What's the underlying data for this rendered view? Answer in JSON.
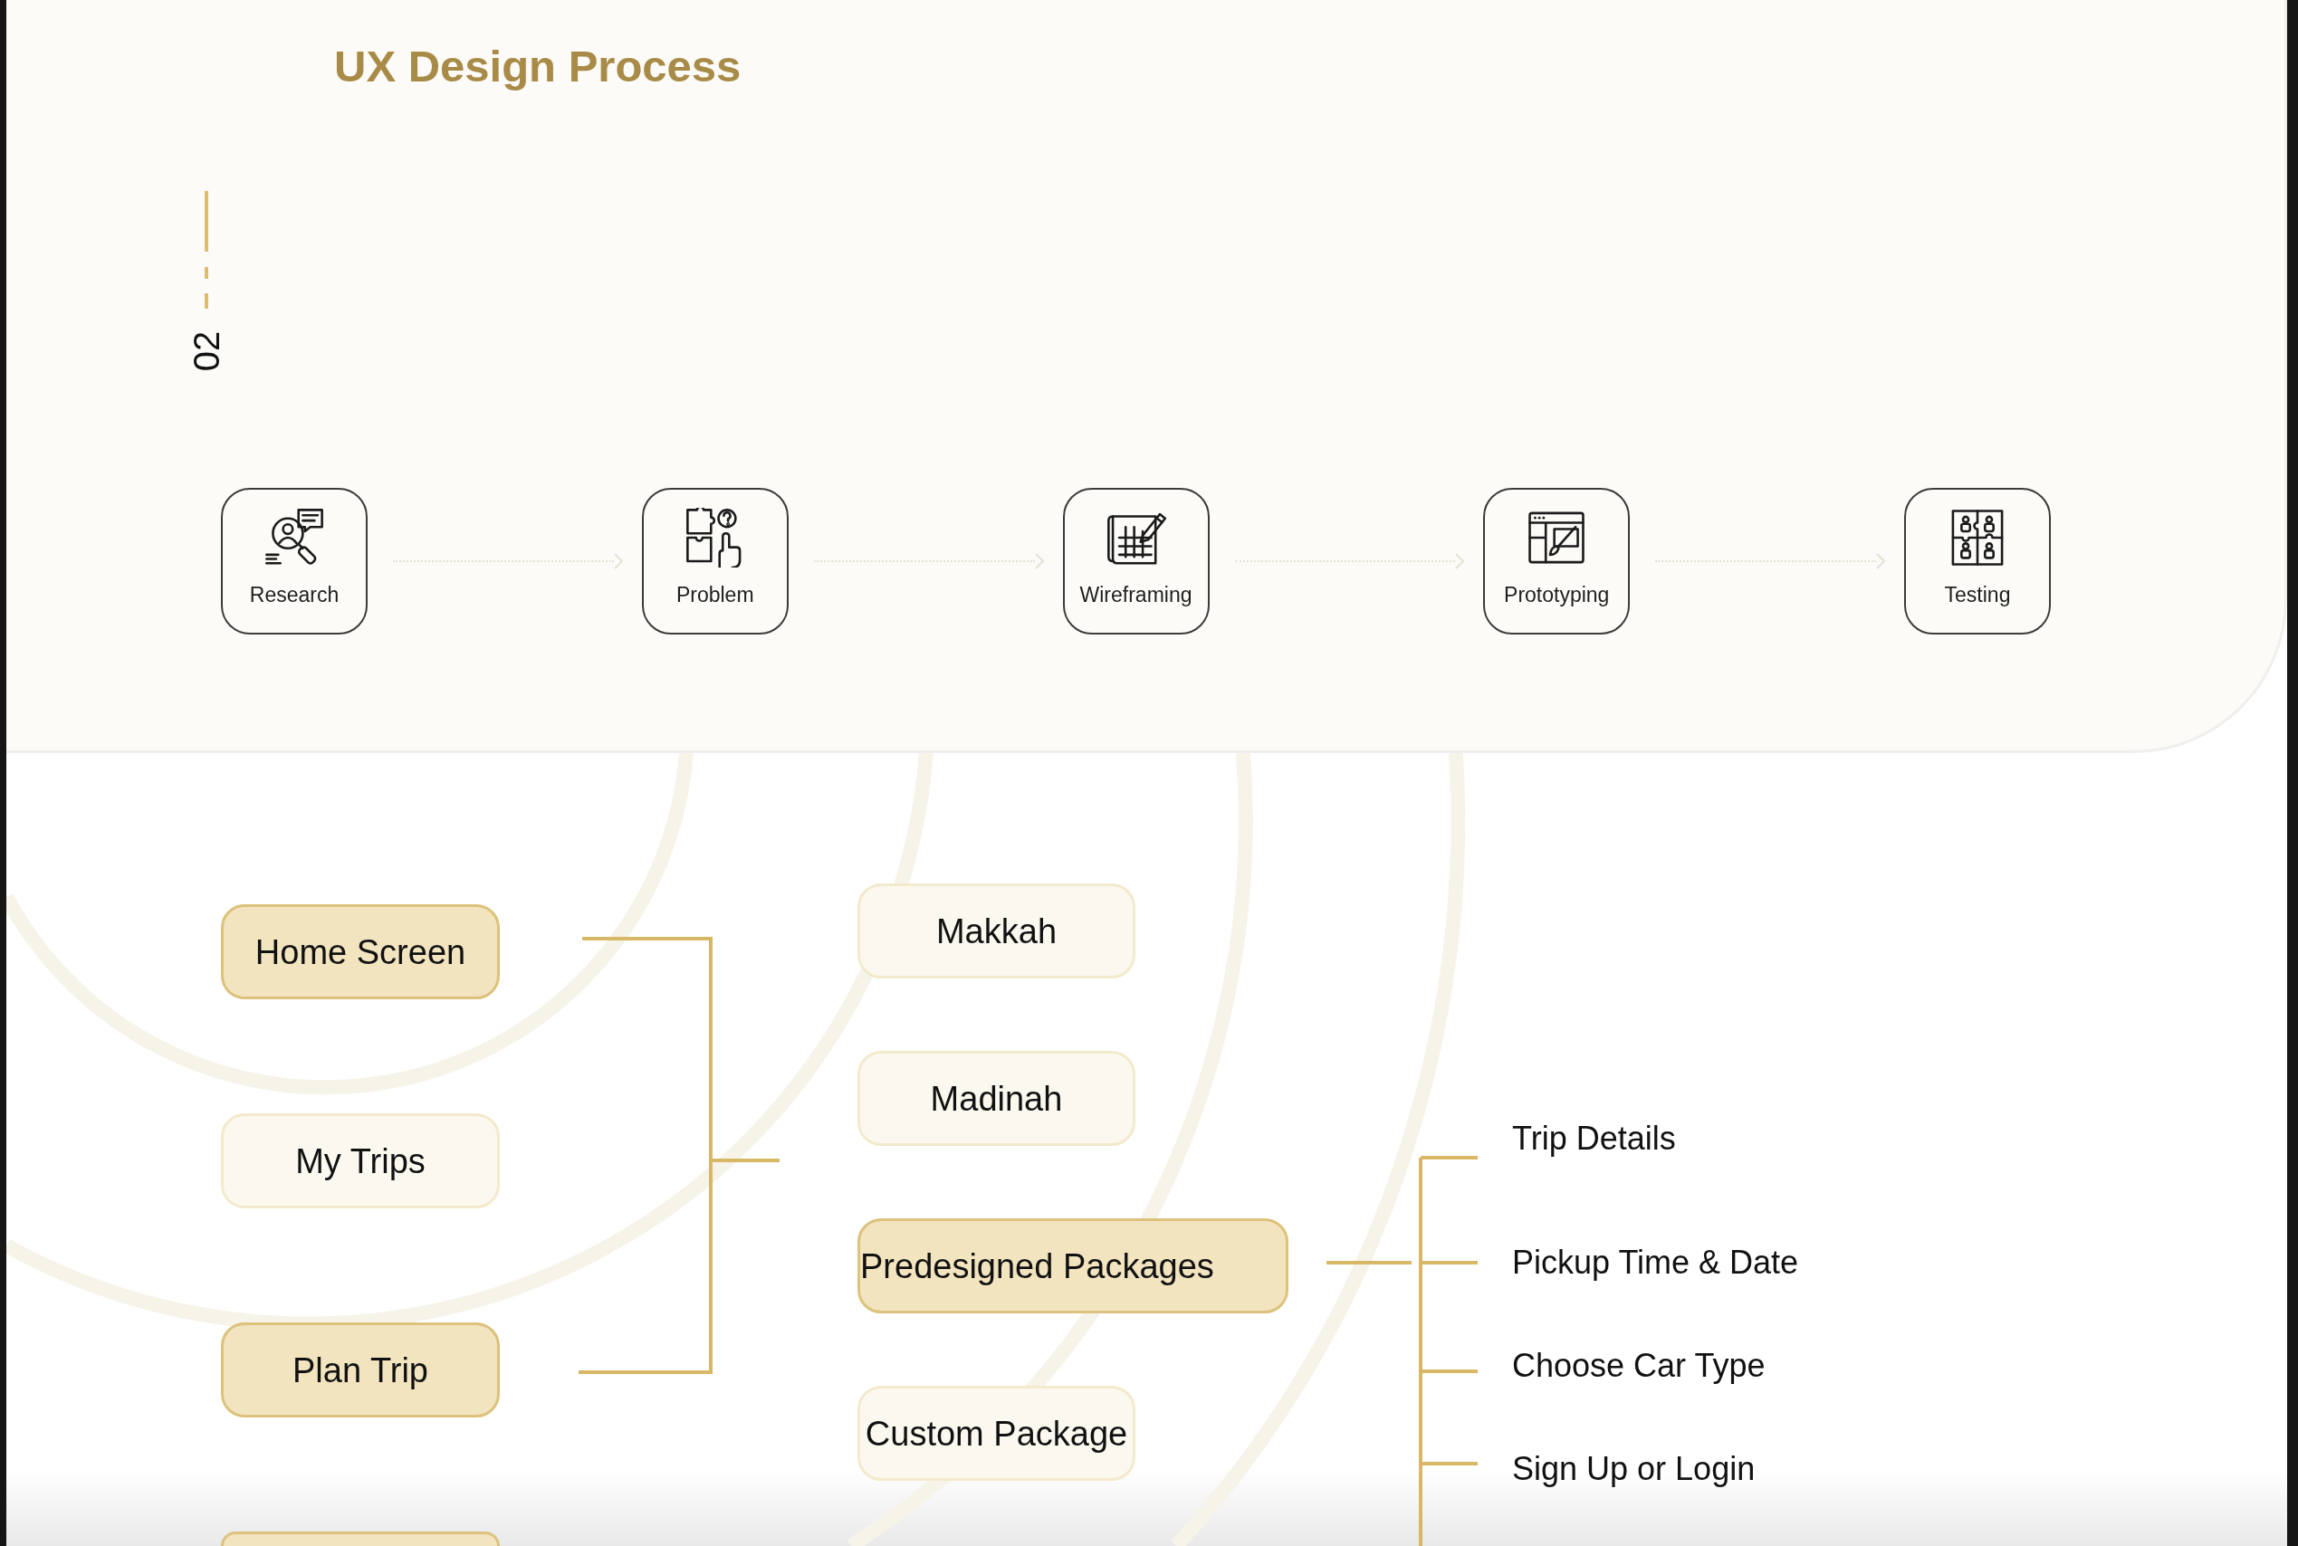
{
  "title": "UX Design Process",
  "section_number": "02",
  "steps": [
    {
      "label": "Research"
    },
    {
      "label": "Problem"
    },
    {
      "label": "Wireframing"
    },
    {
      "label": "Prototyping"
    },
    {
      "label": "Testing"
    }
  ],
  "sitemap": {
    "screens": [
      {
        "label": "Home Screen",
        "highlighted": true
      },
      {
        "label": "My Trips",
        "highlighted": false
      },
      {
        "label": "Plan Trip",
        "highlighted": true
      },
      {
        "highlighted": true
      }
    ],
    "trip_options": [
      {
        "label": "Makkah",
        "highlighted": false
      },
      {
        "label": "Madinah",
        "highlighted": false
      },
      {
        "label": "Predesigned Packages",
        "highlighted": true
      },
      {
        "label": "Custom Package",
        "highlighted": false
      }
    ],
    "package_steps": [
      {
        "label": "Trip Details"
      },
      {
        "label": "Pickup Time & Date"
      },
      {
        "label": "Choose Car Type"
      },
      {
        "label": "Sign Up or Login"
      }
    ]
  }
}
